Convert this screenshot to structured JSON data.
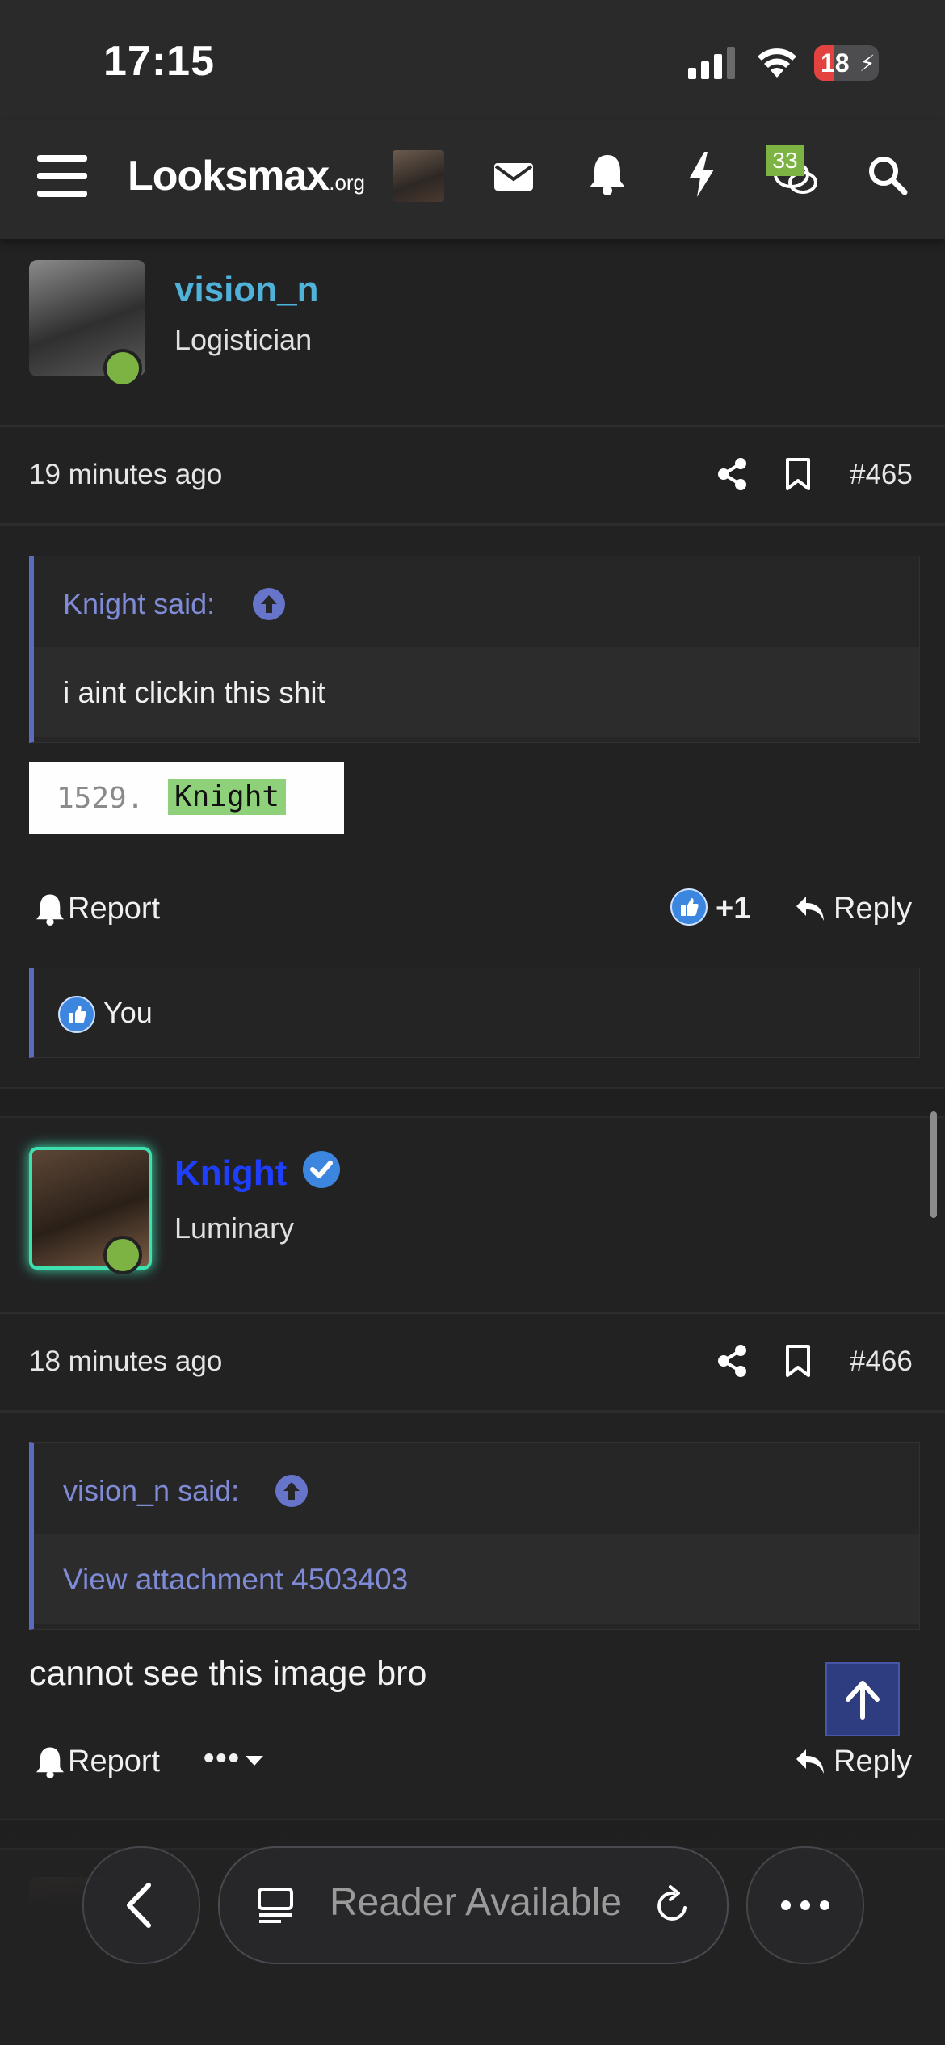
{
  "status_bar": {
    "time": "17:15",
    "battery": "18"
  },
  "nav": {
    "logo_main": "Looksmax",
    "logo_suffix": ".org",
    "chat_badge": "33"
  },
  "posts": [
    {
      "username": "vision_n",
      "user_title": "Logistician",
      "time": "19 minutes ago",
      "number": "#465",
      "quote_author": "Knight said:",
      "quote_text": "i aint clickin this shit",
      "image_line_number": "1529.",
      "image_highlight": "Knight",
      "report_label": "Report",
      "reaction_count": "+1",
      "reply_label": "Reply",
      "reactors": "You"
    },
    {
      "username": "Knight",
      "user_title": "Luminary",
      "time": "18 minutes ago",
      "number": "#466",
      "quote_author": "vision_n said:",
      "quote_text": "View attachment 4503403",
      "message": "cannot see this image bro",
      "report_label": "Report",
      "more_label": "•••",
      "reply_label": "Reply"
    }
  ],
  "browser_bar": {
    "reader_text": "Reader Available"
  },
  "colors": {
    "background": "#222223",
    "accent_quote": "#5c6bc0",
    "online": "#7cb342",
    "username_1": "#4fb3d9",
    "username_2": "#1f3fff",
    "like_blue": "#3d86e0"
  }
}
